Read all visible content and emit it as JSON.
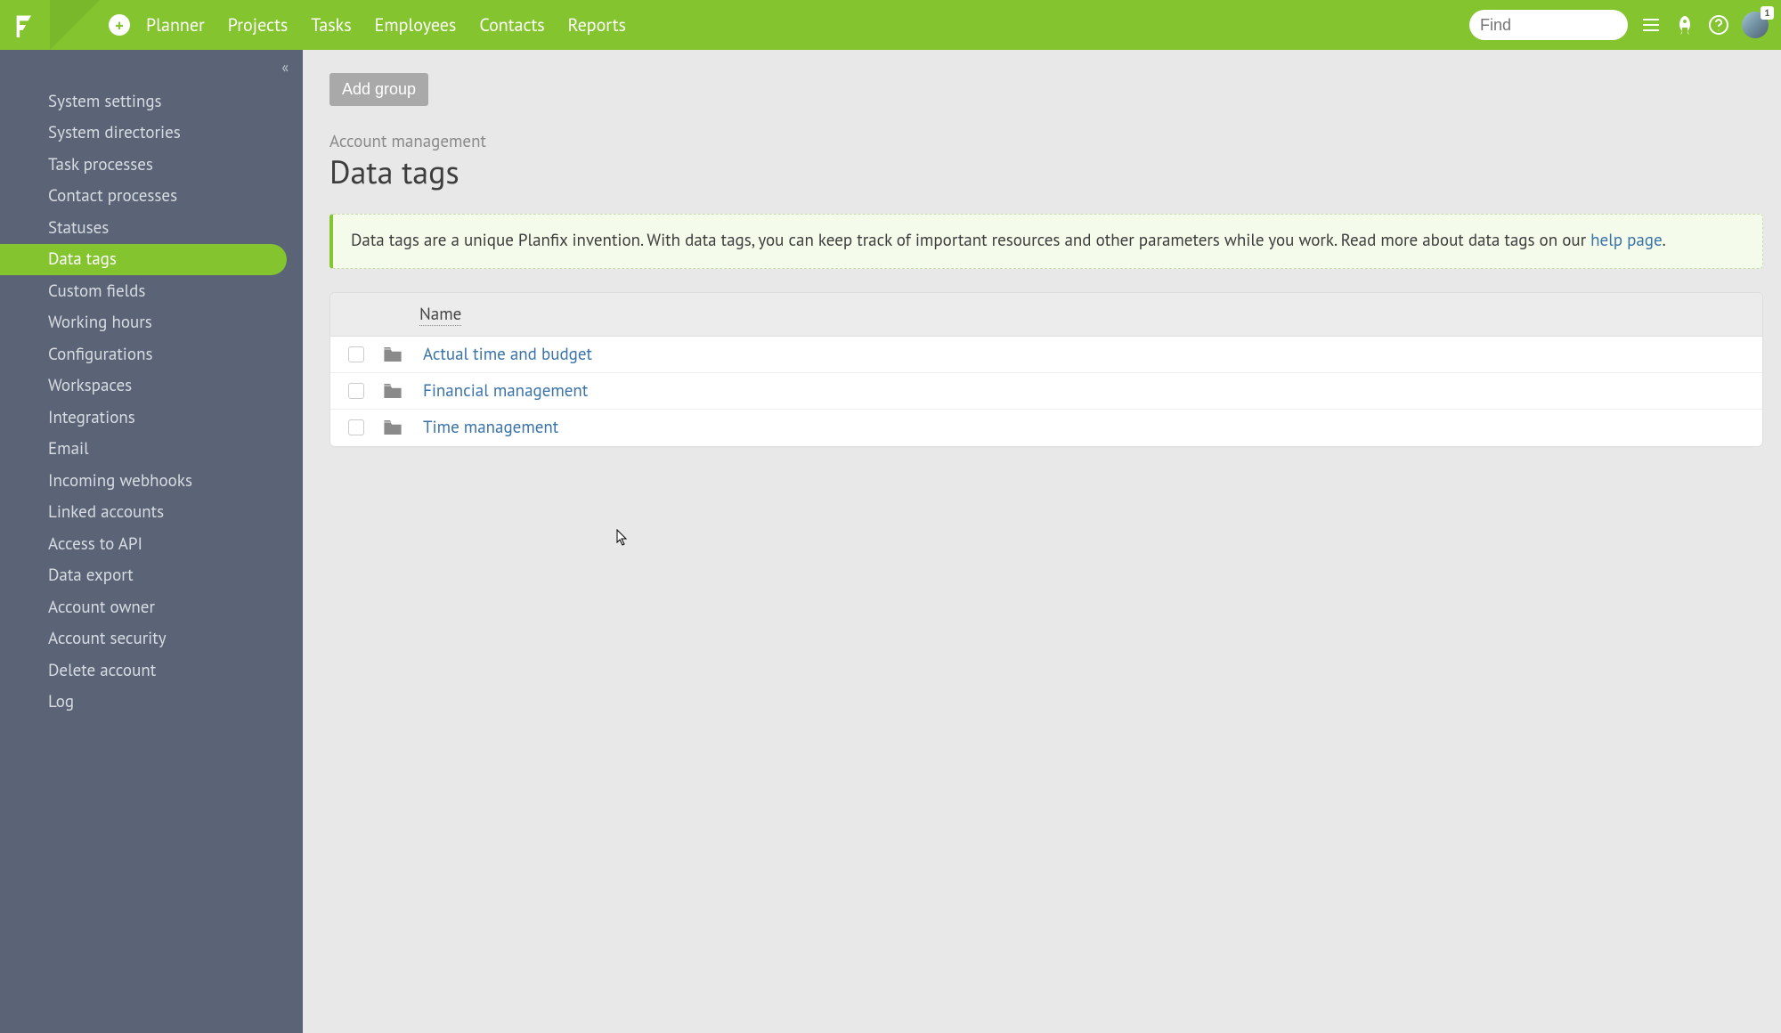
{
  "header": {
    "search_placeholder": "Find",
    "nav": [
      "Planner",
      "Projects",
      "Tasks",
      "Employees",
      "Contacts",
      "Reports"
    ],
    "avatar_badge": "1"
  },
  "sidebar": {
    "items": [
      {
        "label": "System settings",
        "active": false
      },
      {
        "label": "System directories",
        "active": false
      },
      {
        "label": "Task processes",
        "active": false
      },
      {
        "label": "Contact processes",
        "active": false
      },
      {
        "label": "Statuses",
        "active": false
      },
      {
        "label": "Data tags",
        "active": true
      },
      {
        "label": "Custom fields",
        "active": false
      },
      {
        "label": "Working hours",
        "active": false
      },
      {
        "label": "Configurations",
        "active": false
      },
      {
        "label": "Workspaces",
        "active": false
      },
      {
        "label": "Integrations",
        "active": false
      },
      {
        "label": "Email",
        "active": false
      },
      {
        "label": "Incoming webhooks",
        "active": false
      },
      {
        "label": "Linked accounts",
        "active": false
      },
      {
        "label": "Access to API",
        "active": false
      },
      {
        "label": "Data export",
        "active": false
      },
      {
        "label": "Account owner",
        "active": false
      },
      {
        "label": "Account security",
        "active": false
      },
      {
        "label": "Delete account",
        "active": false
      },
      {
        "label": "Log",
        "active": false
      }
    ]
  },
  "main": {
    "add_group_label": "Add group",
    "breadcrumb": "Account management",
    "page_title": "Data tags",
    "info_text_1": "Data tags are a unique Planfix invention. With data tags, you can keep track of important resources and other parameters while you work. Read more about data tags on our ",
    "info_link": "help page",
    "info_text_2": ".",
    "column_name": "Name",
    "rows": [
      {
        "name": "Actual time and budget"
      },
      {
        "name": "Financial management"
      },
      {
        "name": "Time management"
      }
    ]
  }
}
